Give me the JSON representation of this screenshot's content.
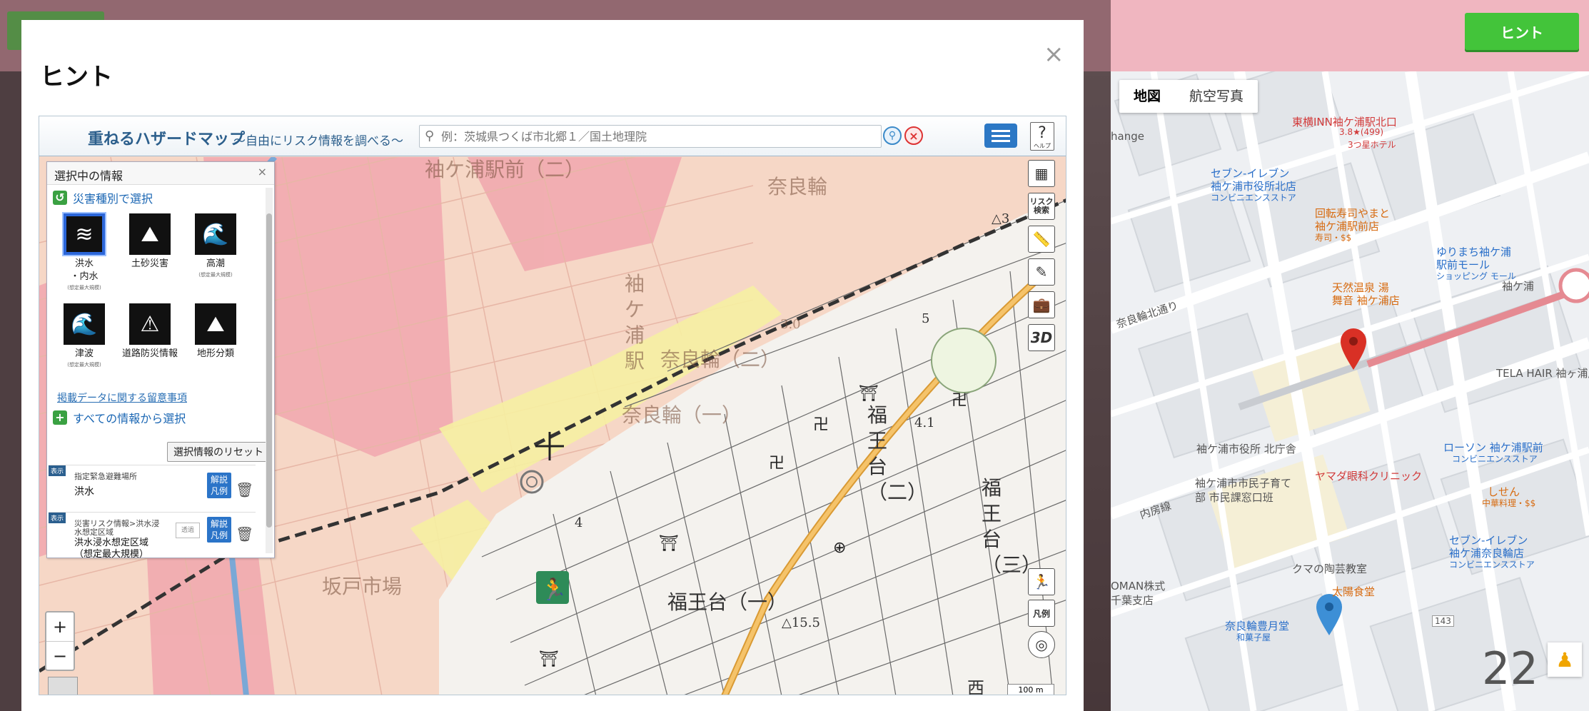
{
  "top_hint_button": "ヒント",
  "modal": {
    "title": "ヒント",
    "close": "×"
  },
  "hazard_map": {
    "title": "重ねるハザードマップ",
    "subtitle": "～自由にリスク情報を調べる～",
    "search_placeholder": "例：茨城県つくば市北郷１／国土地理院",
    "help_label": "ヘルプ",
    "tools": {
      "risk_search": "リスク検索",
      "three_d": "3D"
    },
    "panel": {
      "title": "選択中の情報",
      "section_by_type": "災害種別で選択",
      "categories": [
        {
          "label": "洪水",
          "label2": "・内水",
          "note": "(想定最大規模)",
          "selected": true
        },
        {
          "label": "土砂災害",
          "label2": "",
          "note": "",
          "selected": false
        },
        {
          "label": "高潮",
          "label2": "",
          "note": "(想定最大規模)",
          "selected": false
        },
        {
          "label": "津波",
          "label2": "",
          "note": "(想定最大規模)",
          "selected": false
        },
        {
          "label": "道路防災情報",
          "label2": "",
          "note": "",
          "selected": false
        },
        {
          "label": "地形分類",
          "label2": "",
          "note": "",
          "selected": false
        }
      ],
      "notes_link": "掲載データに関する留意事項",
      "section_all": "すべての情報から選択",
      "reset_button": "選択情報のリセット",
      "layers": [
        {
          "tag": "表示",
          "title": "指定緊急避難場所",
          "name": "洪水",
          "legend": "解説凡例"
        },
        {
          "tag": "表示",
          "title": "災害リスク情報>洪水浸水想定区域",
          "name": "洪水浸水想定区域",
          "name2": "（想定最大規模）",
          "legend": "解説凡例",
          "opacity": "透過"
        }
      ]
    },
    "map_labels": {
      "area1": "袖ケ浦駅前（二）",
      "area2": "奈良輪",
      "station": "袖ケ浦駅",
      "area3": "奈良輪（二）",
      "area4": "奈良輪（一）",
      "area5": "福王台（二）",
      "area6": "福王台（三）",
      "area7": "福王台（一）",
      "area8": "坂戸市場",
      "elev1": "△15.5",
      "elev2": "△3",
      "elev3": "5",
      "elev4": "4",
      "elev5": "3.0",
      "elev6": "4.1",
      "west": "西",
      "scale": "100 m",
      "legend_btn": "凡例"
    },
    "zoom_in": "+",
    "zoom_out": "−"
  },
  "google_map": {
    "map_type": [
      "地図",
      "航空写真"
    ],
    "zoom_level": "22",
    "pois": {
      "toyoko": "東横INN袖ケ浦駅北口",
      "toyoko_rating": "3.8★(499)",
      "toyoko_sub": "3つ星ホテル",
      "seven1": "セブン-イレブン",
      "seven1b": "袖ケ浦市役所北店",
      "seven1c": "コンビニエンスストア",
      "sushi": "回転寿司やまと",
      "sushi2": "袖ケ浦駅前店",
      "sushi3": "寿司・$$",
      "yurimachi": "ゆりまち袖ケ浦",
      "yurimachi2": "駅前モール",
      "yurimachi3": "ショッピング モール",
      "sodegaura": "袖ケ浦",
      "onsen": "天然温泉 湯",
      "onsen2": "舞音 袖ケ浦店",
      "road1": "奈良輪北通り",
      "tela": "TELA HAIR 袖ヶ浦店",
      "cityhall": "袖ケ浦市役所 北庁舎",
      "lawson": "ローソン 袖ケ浦駅前",
      "lawson2": "コンビニエンスストア",
      "yamada": "ヤマダ眼科クリニック",
      "child": "袖ケ浦市市民子育て",
      "child2": "部 市民課窓口班",
      "shisen": "しせん",
      "shisen2": "中華料理・$$",
      "road2": "内房線",
      "seven2": "セブン-イレブン",
      "seven2b": "袖ケ浦奈良輪店",
      "seven2c": "コンビニエンスストア",
      "kuma": "クマの陶芸教室",
      "taiyo": "太陽食堂",
      "naraya": "奈良輪豊月堂",
      "naraya2": "和菓子屋",
      "oman": "OMAN株式",
      "oman2": "千葉支店",
      "change": "hange",
      "route": "143"
    }
  },
  "colors": {
    "top_bar": "#f0b6c0",
    "hint_green": "#43c43a",
    "flood_pink": "#f2aab0",
    "flood_yellow": "#f7f2a8"
  }
}
